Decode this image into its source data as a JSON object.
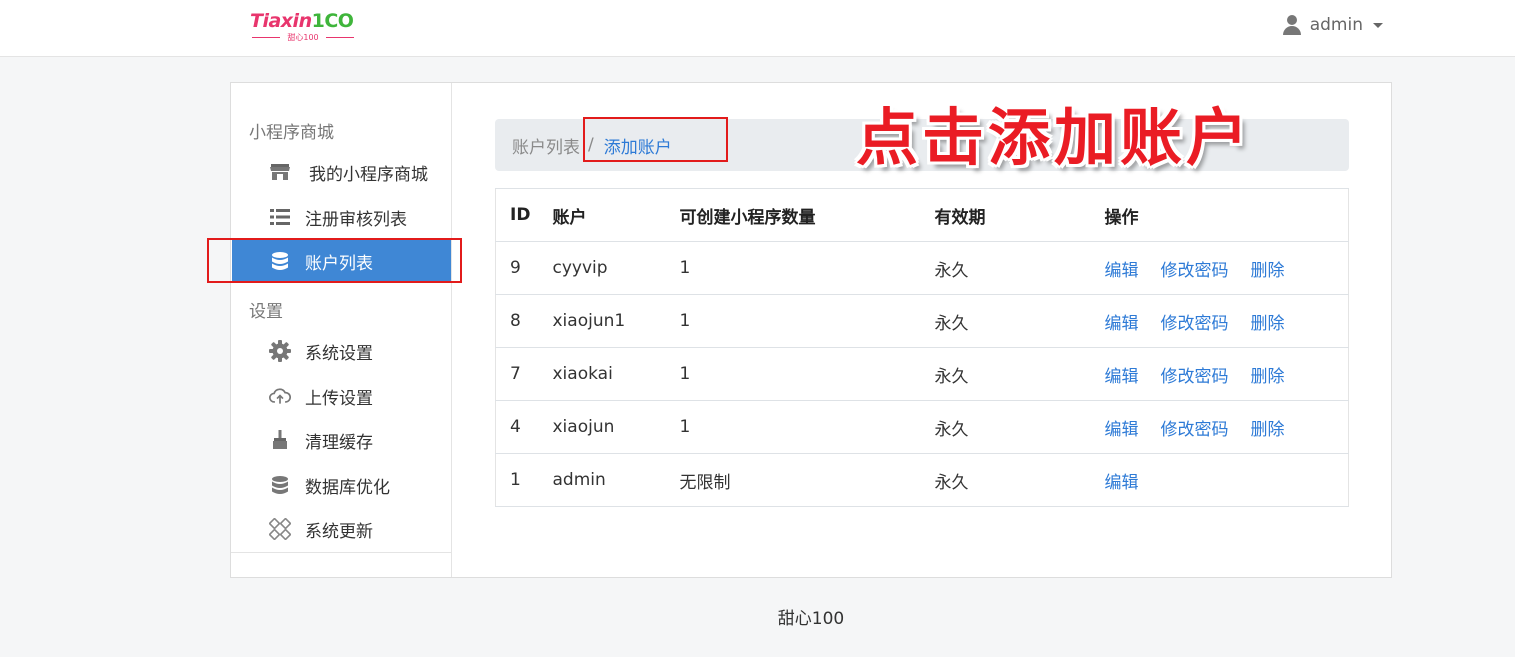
{
  "header": {
    "logo_text": "Tiaxin",
    "logo_num": "1CO",
    "logo_sub": "甜心100",
    "user_name": "admin",
    "user_icon": "user-icon"
  },
  "sidebar": {
    "groups": [
      {
        "title": "小程序商城",
        "items": [
          {
            "label": "我的小程序商城",
            "icon": "store-icon"
          },
          {
            "label": "注册审核列表",
            "icon": "list-icon"
          },
          {
            "label": "账户列表",
            "icon": "database-icon",
            "active": true
          }
        ]
      },
      {
        "title": "设置",
        "items": [
          {
            "label": "系统设置",
            "icon": "gear-icon"
          },
          {
            "label": "上传设置",
            "icon": "cloud-upload-icon"
          },
          {
            "label": "清理缓存",
            "icon": "broom-icon"
          },
          {
            "label": "数据库优化",
            "icon": "database-icon"
          },
          {
            "label": "系统更新",
            "icon": "update-icon"
          }
        ]
      }
    ]
  },
  "breadcrumb": {
    "item": "账户列表",
    "separator": "/",
    "active": "添加账户"
  },
  "callout": "点击添加账户",
  "table": {
    "headers": [
      "ID",
      "账户",
      "可创建小程序数量",
      "有效期",
      "操作"
    ],
    "rows": [
      {
        "id": "9",
        "account": "cyyvip",
        "quota": "1",
        "expiry": "永久",
        "actions": [
          "编辑",
          "修改密码",
          "删除"
        ]
      },
      {
        "id": "8",
        "account": "xiaojun1",
        "quota": "1",
        "expiry": "永久",
        "actions": [
          "编辑",
          "修改密码",
          "删除"
        ]
      },
      {
        "id": "7",
        "account": "xiaokai",
        "quota": "1",
        "expiry": "永久",
        "actions": [
          "编辑",
          "修改密码",
          "删除"
        ]
      },
      {
        "id": "4",
        "account": "xiaojun",
        "quota": "1",
        "expiry": "永久",
        "actions": [
          "编辑",
          "修改密码",
          "删除"
        ]
      },
      {
        "id": "1",
        "account": "admin",
        "quota": "无限制",
        "expiry": "永久",
        "actions": [
          "编辑"
        ]
      }
    ]
  },
  "footer": "甜心100",
  "colors": {
    "accent": "#3f87d5",
    "link": "#2d7ad6",
    "highlight": "#e21b1b",
    "brand_pink": "#e8356d",
    "brand_green": "#3fb53b"
  }
}
